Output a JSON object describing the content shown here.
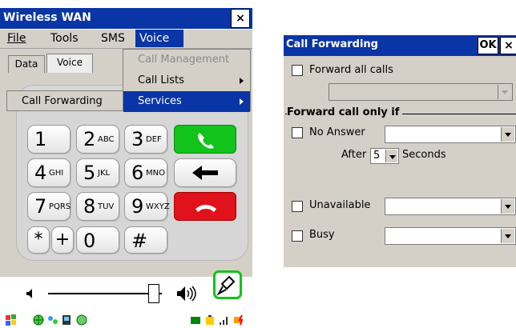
{
  "left_window": {
    "title": "Wireless WAN",
    "close_label": "×",
    "menubar": {
      "file": "File",
      "tools": "Tools",
      "sms": "SMS",
      "voice": "Voice"
    },
    "tabs": {
      "data": "Data",
      "voice": "Voice"
    },
    "voice_menu": {
      "items": [
        {
          "label": "Call Management",
          "enabled": false
        },
        {
          "label": "Call Lists",
          "has_submenu": true
        },
        {
          "label": "Services",
          "has_submenu": true,
          "selected": true
        }
      ]
    },
    "submenu": {
      "call_forwarding": "Call Forwarding"
    },
    "keypad": {
      "keys": [
        {
          "digit": "1",
          "letters": ""
        },
        {
          "digit": "2",
          "letters": "ABC"
        },
        {
          "digit": "3",
          "letters": "DEF"
        },
        {
          "digit": "4",
          "letters": "GHI"
        },
        {
          "digit": "5",
          "letters": "JKL"
        },
        {
          "digit": "6",
          "letters": "MNO"
        },
        {
          "digit": "7",
          "letters": "PQRS"
        },
        {
          "digit": "8",
          "letters": "TUV"
        },
        {
          "digit": "9",
          "letters": "WXYZ"
        }
      ],
      "star": "*",
      "plus": "+",
      "zero": "0",
      "hash": "#"
    },
    "colors": {
      "call": "#11c31a",
      "end": "#e0121b",
      "titlebar": "#0a35a6"
    },
    "volume": {
      "level": 0.88
    }
  },
  "right_window": {
    "title": "Call Forwarding",
    "ok_label": "OK",
    "close_label": "×",
    "forward_all_label": "Forward all calls",
    "group_label": "Forward call only if",
    "no_answer_label": "No Answer",
    "after_label": "After",
    "after_value": "5",
    "seconds_label": "Seconds",
    "unavailable_label": "Unavailable",
    "busy_label": "Busy"
  }
}
